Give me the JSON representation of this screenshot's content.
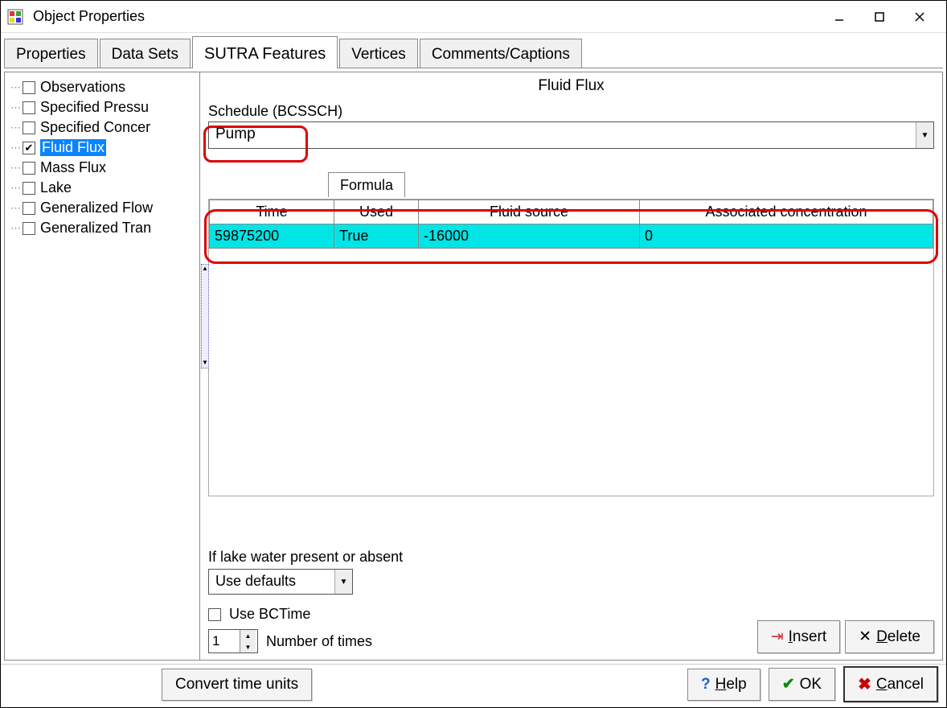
{
  "window": {
    "title": "Object Properties"
  },
  "tabs": {
    "properties": "Properties",
    "data_sets": "Data Sets",
    "sutra": "SUTRA Features",
    "vertices": "Vertices",
    "comments": "Comments/Captions"
  },
  "tree": {
    "items": [
      {
        "label": "Observations",
        "checked": false,
        "selected": false
      },
      {
        "label": "Specified Pressu",
        "checked": false,
        "selected": false
      },
      {
        "label": "Specified Concer",
        "checked": false,
        "selected": false
      },
      {
        "label": "Fluid Flux",
        "checked": true,
        "selected": true
      },
      {
        "label": "Mass Flux",
        "checked": false,
        "selected": false
      },
      {
        "label": "Lake",
        "checked": false,
        "selected": false
      },
      {
        "label": "Generalized Flow",
        "checked": false,
        "selected": false
      },
      {
        "label": "Generalized Tran",
        "checked": false,
        "selected": false
      }
    ]
  },
  "panel": {
    "title": "Fluid Flux",
    "schedule_label": "Schedule (BCSSCH)",
    "schedule_value": "Pump",
    "formula_tab": "Formula",
    "table": {
      "headers": [
        "Time",
        "Used",
        "Fluid source",
        "Associated concentration"
      ],
      "rows": [
        {
          "time": "59875200",
          "used": "True",
          "fluid_source": "-16000",
          "assoc_conc": "0"
        }
      ]
    },
    "lake_label": "If lake water present or absent",
    "lake_value": "Use defaults",
    "use_bctime_label": "Use BCTime",
    "use_bctime_checked": false,
    "num_times_value": "1",
    "num_times_label": "Number of times",
    "insert_label": "Insert",
    "delete_label": "Delete"
  },
  "buttons": {
    "convert": "Convert time units",
    "help": "Help",
    "ok": "OK",
    "cancel": "Cancel"
  }
}
